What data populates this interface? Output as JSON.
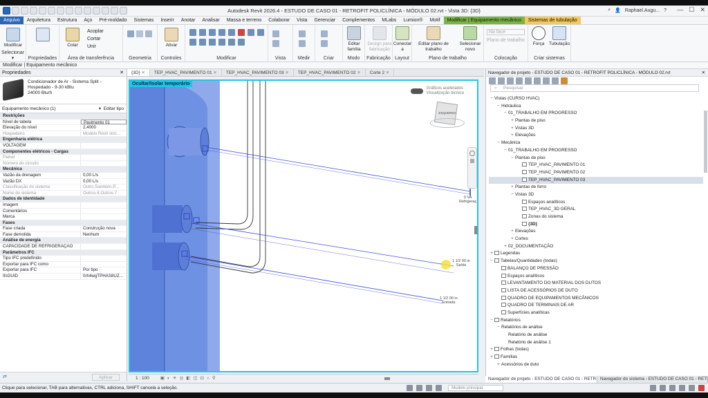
{
  "window": {
    "title": "Autodesk Revit 2026.4 - ESTUDO DE CASO 01 - RETROFIT POLICLÍNICA - MÓDULO 02.rvt - Vista 3D: {3D}",
    "user": "Raphael.Augu..."
  },
  "ribbon_tabs": [
    "Arquivo",
    "Arquitetura",
    "Estrutura",
    "Aço",
    "Pré-moldado",
    "Sistemas",
    "Inserir",
    "Anotar",
    "Analisar",
    "Massa e terreno",
    "Colaborar",
    "Vista",
    "Gerenciar",
    "Complementos",
    "MLabs",
    "Lumion®",
    "Motif",
    "Modificar | Equipamento mecânico",
    "Sistemas de tubulação"
  ],
  "ribbon": {
    "modify_button": "Modificar",
    "paste_button": "Colar",
    "copy_button": "Acoplar",
    "cut_button": "Cortar",
    "join_button": "Unir",
    "activate_button": "Ativar",
    "edit_family": "Editar família",
    "edit_family_disabled": "Design para fabricação",
    "connect_to": "Conectar a",
    "edit_workplane": "Editar plano de trabalho",
    "pick_new": "Selecionar novo",
    "place_on_face": "Na face",
    "workplane_placement": "Plano de trabalho",
    "force": "Força",
    "piping": "Tubulação",
    "groups": {
      "select": "Selecionar ▾",
      "properties": "Propriedades",
      "clipboard": "Área de transferência",
      "geometry": "Geometria",
      "controls": "Controles",
      "modify": "Modificar",
      "view": "Vista",
      "measure": "Medir",
      "create": "Criar",
      "mode": "Modo",
      "fabrication": "Fabricação",
      "layout": "Layout",
      "workplane": "Plano de trabalho",
      "placement": "Colocação",
      "create_systems": "Criar sistemas"
    }
  },
  "mode_bar": "Modificar | Equipamento mecânico",
  "properties": {
    "header": "Propriedades",
    "type_name_1": "Condicionador de Ar - Sistema Split -",
    "type_name_2": "Hospedado - 9-30 kBtu",
    "type_name_3": "24000 Btu/h",
    "instance_filter": "Equipamento mecânico (1)",
    "edit_type": "Editar tipo",
    "apply": "Aplicar",
    "rows": [
      {
        "n": "Restrições",
        "v": "",
        "t": "sec"
      },
      {
        "n": "Nível de tabela",
        "v": "Pavimento 01",
        "t": "boxed"
      },
      {
        "n": "Elevação do nível",
        "v": "2,4000",
        "t": ""
      },
      {
        "n": "Hospedeiro",
        "v": "Modelo Revit vinc...",
        "t": "gray"
      },
      {
        "n": "Engenharia elétrica",
        "v": "",
        "t": "sec"
      },
      {
        "n": "VOLTAGEM",
        "v": "",
        "t": ""
      },
      {
        "n": "Componentes elétricos - Cargas",
        "v": "",
        "t": "sec"
      },
      {
        "n": "Painel",
        "v": "",
        "t": "gray"
      },
      {
        "n": "Número do circuito",
        "v": "",
        "t": "gray"
      },
      {
        "n": "Mecânica",
        "v": "",
        "t": "sec"
      },
      {
        "n": "Vazão da drenagem",
        "v": "0,00 L/s",
        "t": ""
      },
      {
        "n": "Vazão DX",
        "v": "0,00 L/s",
        "t": ""
      },
      {
        "n": "Classificação do sistema",
        "v": "Outro,Sanitário,P...",
        "t": "gray"
      },
      {
        "n": "Nome do sistema",
        "v": "Outros 8,Outros 7",
        "t": "gray"
      },
      {
        "n": "Dados de identidade",
        "v": "",
        "t": "sec"
      },
      {
        "n": "Imagem",
        "v": "",
        "t": ""
      },
      {
        "n": "Comentários",
        "v": "",
        "t": ""
      },
      {
        "n": "Marca",
        "v": "",
        "t": ""
      },
      {
        "n": "Fases",
        "v": "",
        "t": "sec"
      },
      {
        "n": "Fase criada",
        "v": "Construção nova",
        "t": ""
      },
      {
        "n": "Fase demolida",
        "v": "Nenhum",
        "t": ""
      },
      {
        "n": "Análise de energia",
        "v": "",
        "t": "sec"
      },
      {
        "n": "CAPACIDADE DE REFRIGERAÇÃO",
        "v": "",
        "t": ""
      },
      {
        "n": "Parâmetros IFC",
        "v": "",
        "t": "sec"
      },
      {
        "n": "Tipo IFC predefinido",
        "v": "",
        "t": ""
      },
      {
        "n": "Exportar para IFC como",
        "v": "",
        "t": ""
      },
      {
        "n": "Exportar para IFC",
        "v": "Por tipo",
        "t": ""
      },
      {
        "n": "IfcGUID",
        "v": "0rh4wgTPHAS8UZ...",
        "t": ""
      }
    ]
  },
  "view_tabs": [
    "{3D}",
    "TEP_HVAC_PAVIMENTO 01",
    "TEP_HVAC_PAVIMENTO 03",
    "TEP_HVAC_PAVIMENTO 02",
    "Corte 2"
  ],
  "viewport": {
    "banner": "Ocultar/Isolar temporário",
    "graphics_label_1": "Gráficos acelerados",
    "graphics_label_2": "Visualização técnica",
    "viewcube_face": "ESQUERDA",
    "annotations": [
      "0 VA",
      "Refrigeraç",
      "Saída",
      "1 1/2 00 in",
      "Entrada"
    ],
    "scale": "1 : 100"
  },
  "browser": {
    "header": "Navegador de projeto - ESTUDO DE CASO 01 - RETROFIT POLICLÍNICA - MÓDULO 02.rvt",
    "search_placeholder": "Pesquisar",
    "tree": [
      {
        "t": "Vistas (CURSO HVAC)",
        "d": 0,
        "g": "−"
      },
      {
        "t": "Hidráulica",
        "d": 1,
        "g": "−"
      },
      {
        "t": "01_TRABALHO EM PROGRESSO",
        "d": 2,
        "g": "−"
      },
      {
        "t": "Plantas de piso",
        "d": 3,
        "g": "+"
      },
      {
        "t": "Vistas 3D",
        "d": 3,
        "g": "+"
      },
      {
        "t": "Elevações",
        "d": 3,
        "g": "+"
      },
      {
        "t": "Mecânica",
        "d": 1,
        "g": "−"
      },
      {
        "t": "01_TRABALHO EM PROGRESSO",
        "d": 2,
        "g": "−"
      },
      {
        "t": "Plantas de piso",
        "d": 3,
        "g": "−"
      },
      {
        "t": "TEP_HVAC_PAVIMENTO 01",
        "d": 4,
        "g": "",
        "i": true
      },
      {
        "t": "TEP_HVAC_PAVIMENTO 02",
        "d": 4,
        "g": "",
        "i": true
      },
      {
        "t": "TEP_HVAC_PAVIMENTO 03",
        "d": 4,
        "g": "",
        "i": true,
        "sel": true
      },
      {
        "t": "Plantas de forro",
        "d": 3,
        "g": "+"
      },
      {
        "t": "Vistas 3D",
        "d": 3,
        "g": "−"
      },
      {
        "t": "Espaços analíticos",
        "d": 4,
        "g": "",
        "i": true
      },
      {
        "t": "TEP_HVAC_3D GERAL",
        "d": 4,
        "g": "",
        "i": true
      },
      {
        "t": "Zonas do sistema",
        "d": 4,
        "g": "",
        "i": true
      },
      {
        "t": "{3D}",
        "d": 4,
        "g": "",
        "i": true,
        "b": true
      },
      {
        "t": "Elevações",
        "d": 3,
        "g": "+"
      },
      {
        "t": "Cortes",
        "d": 3,
        "g": "+"
      },
      {
        "t": "02_DOCUMENTAÇÃO",
        "d": 2,
        "g": "+"
      },
      {
        "t": "Legendas",
        "d": 0,
        "g": "+",
        "i": true
      },
      {
        "t": "Tabelas/Quantidades (todas)",
        "d": 0,
        "g": "−",
        "i": true
      },
      {
        "t": "BALANÇO DE PRESSÃO",
        "d": 1,
        "g": "",
        "i": true
      },
      {
        "t": "Espaços analíticos",
        "d": 1,
        "g": "",
        "i": true
      },
      {
        "t": "LEVANTAMENTO DO MATERIAL DOS DUTOS",
        "d": 1,
        "g": "",
        "i": true
      },
      {
        "t": "LISTA DE ACESSÓRIOS DE DUTO",
        "d": 1,
        "g": "",
        "i": true
      },
      {
        "t": "QUADRO DE EQUIPAMENTOS MECÂNICOS",
        "d": 1,
        "g": "",
        "i": true
      },
      {
        "t": "QUADRO DE TERMINAIS DE AR",
        "d": 1,
        "g": "",
        "i": true
      },
      {
        "t": "Superfícies analíticas",
        "d": 1,
        "g": "",
        "i": true
      },
      {
        "t": "Relatórios",
        "d": 0,
        "g": "−",
        "i": true
      },
      {
        "t": "Relatórios de análise",
        "d": 1,
        "g": "−"
      },
      {
        "t": "Relatório de análise",
        "d": 2,
        "g": ""
      },
      {
        "t": "Relatório de análise 1",
        "d": 2,
        "g": ""
      },
      {
        "t": "Folhas (todas)",
        "d": 0,
        "g": "+",
        "i": true
      },
      {
        "t": "Famílias",
        "d": 0,
        "g": "+",
        "i": true
      },
      {
        "t": "Acessórios de duto",
        "d": 1,
        "g": "+"
      }
    ],
    "tab_1": "Navegador de projeto - ESTUDO DE CASO 01 - RETR...",
    "tab_2": "Navegador do sistema - ESTUDO DE CASO 01 - RETR..."
  },
  "status": {
    "hint": "Clique para selecionar, TAB para alternativas, CTRL adiciona, SHIFT cancela a seleção.",
    "model": "Modelo principal"
  }
}
